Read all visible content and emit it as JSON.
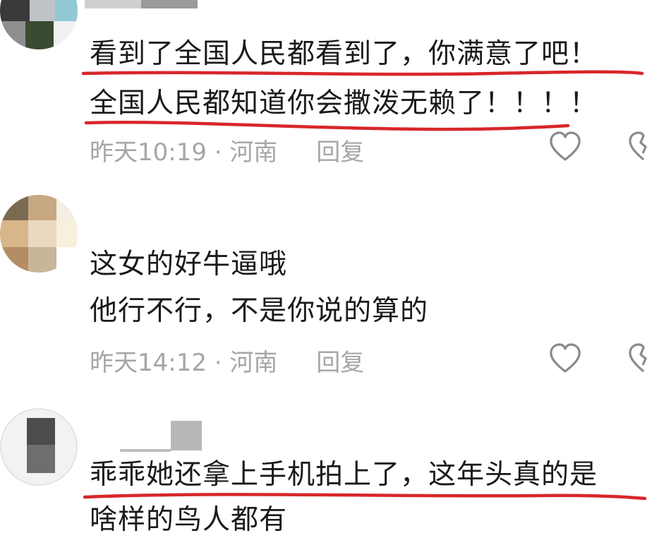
{
  "comments": [
    {
      "lines": [
        "看到了全国人民都看到了，你满意了吧！",
        "全国人民都知道你会撒泼无赖了！！！！"
      ],
      "time": "昨天10:19",
      "location": "河南",
      "reply": "回复",
      "underlined": true
    },
    {
      "lines": [
        "这女的好牛逼哦",
        "他行不行，不是你说的算的"
      ],
      "time": "昨天14:12",
      "location": "河南",
      "reply": "回复",
      "underlined": false
    },
    {
      "lines": [
        "乖乖她还拿上手机拍上了，这年头真的是",
        "啥样的鸟人都有"
      ],
      "underlined": true
    }
  ],
  "meta_separator": " · ",
  "icons": {
    "like": "heart-outline-icon",
    "dislike": "broken-heart-icon"
  },
  "colors": {
    "underline": "#d8262b",
    "meta_text": "#a6a6a6",
    "text": "#1a1a1a"
  }
}
